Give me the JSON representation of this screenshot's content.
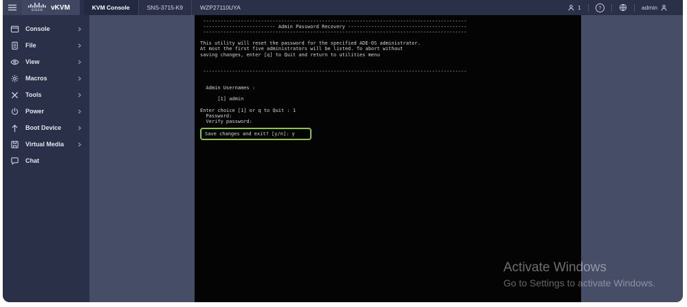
{
  "header": {
    "logo_word": "cisco",
    "product": "vKVM",
    "tabs": [
      {
        "label": "KVM Console"
      },
      {
        "label": "SNS-3715-K9"
      },
      {
        "label": "WZP27110UYA"
      }
    ],
    "session_count": "1",
    "help_glyph": "?",
    "username": "admin"
  },
  "sidebar": {
    "items": [
      {
        "label": "Console"
      },
      {
        "label": "File"
      },
      {
        "label": "View"
      },
      {
        "label": "Macros"
      },
      {
        "label": "Tools"
      },
      {
        "label": "Power"
      },
      {
        "label": "Boot Device"
      },
      {
        "label": "Virtual Media"
      },
      {
        "label": "Chat"
      }
    ]
  },
  "terminal": {
    "title": "Admin Password Recovery",
    "body": " -------------------------------------------------------------------------------------------\n ------------------------- Admin Password Recovery -----------------------------------------\n -------------------------------------------------------------------------------------------\n\nThis utility will reset the password for the specified ADE-OS administrator.\nAt most the first five administrators will be listed. To abort without\nsaving changes, enter [q] to Quit and return to utilities menu\n\n\n -------------------------------------------------------------------------------------------\n\n\n  Admin Usernames :\n\n      [1] admin\n\nEnter choice [1] or q to Quit : 1\n  Password:\n  Verify password:",
    "prompt_highlighted": "Save changes and exit? [y/n]: y",
    "highlight_color": "#8cc63f"
  },
  "watermark": {
    "line1": "Activate Windows",
    "line2": "Go to Settings to activate Windows."
  },
  "colors": {
    "header_bg": "#2a3048",
    "sidebar_bg": "#2a3047",
    "panel_bg": "#464d66",
    "terminal_bg": "#040404",
    "highlight_border": "#8cc63f"
  }
}
